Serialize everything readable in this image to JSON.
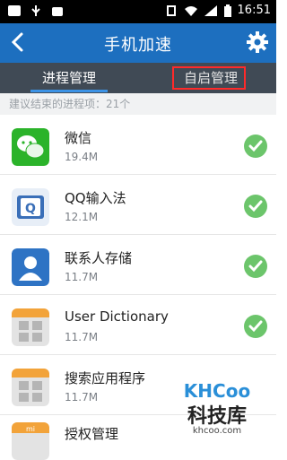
{
  "statusbar": {
    "time": "16:51"
  },
  "header": {
    "title": "手机加速"
  },
  "tabs": [
    {
      "label": "进程管理",
      "active": true
    },
    {
      "label": "自启管理",
      "active": false
    }
  ],
  "subhead": "建议结束的进程项：21个",
  "apps": [
    {
      "name": "微信",
      "size": "19.4M",
      "icon": "wechat-icon"
    },
    {
      "name": "QQ输入法",
      "size": "12.1M",
      "icon": "qq-input-icon"
    },
    {
      "name": "联系人存储",
      "size": "11.7M",
      "icon": "contacts-storage-icon"
    },
    {
      "name": "User Dictionary",
      "size": "11.7M",
      "icon": "user-dictionary-icon"
    },
    {
      "name": "搜索应用程序",
      "size": "11.7M",
      "icon": "search-app-icon"
    },
    {
      "name": "授权管理",
      "size": "",
      "icon": "auth-manager-icon"
    }
  ],
  "watermark": {
    "brand": "KHCoo",
    "text": "科技库",
    "url": "khcoo.com"
  },
  "colors": {
    "header": "#1d6fbf",
    "tabs_bg": "#404a55",
    "tab_underline": "#3c93e6",
    "check": "#6cc56b",
    "highlight_box": "#ff2a2a"
  }
}
